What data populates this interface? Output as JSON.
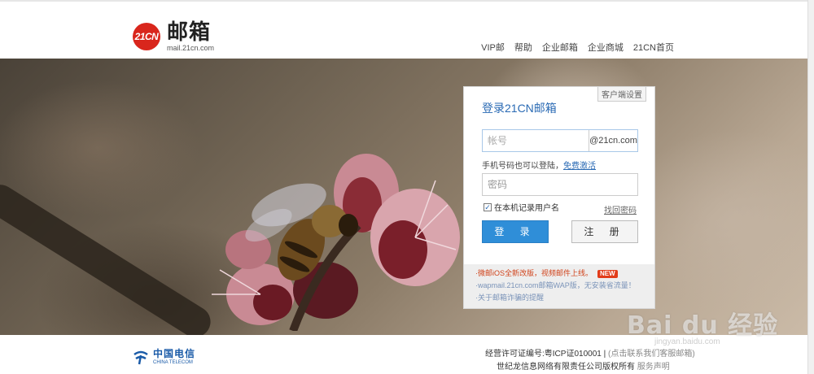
{
  "header": {
    "logo_badge": "21CN",
    "logo_title": "邮箱",
    "logo_sub": "mail.21cn.com",
    "nav": [
      "VIP邮",
      "帮助",
      "企业邮箱",
      "企业商城",
      "21CN首页"
    ]
  },
  "login": {
    "client_settings": "客户端设置",
    "title": "登录21CN邮箱",
    "username_placeholder": "帐号",
    "domain": "@21cn.com",
    "hint_text": "手机号码也可以登陆，",
    "hint_link": "免费激活",
    "password_placeholder": "密码",
    "remember_label": "在本机记录用户名",
    "remember_checked": true,
    "forgot_link": "找回密码",
    "login_button": "登 录",
    "register_button": "注 册"
  },
  "news": [
    {
      "text": "·微邮iOS全新改版，视频邮件上线。",
      "badge": "NEW"
    },
    {
      "text": "·wapmail.21cn.com邮箱WAP版，无安装省流量！"
    },
    {
      "text": "·关于邮箱诈骗的提醒"
    }
  ],
  "footer": {
    "telecom_cn": "中国电信",
    "telecom_en": "CHINA TELECOM",
    "license": "经营许可证编号:粤ICP证010001 |",
    "license_soft": "(点击联系我们客服邮箱)",
    "copyright": "世纪龙信息网络有限责任公司版权所有",
    "service_link": "服务声明"
  },
  "watermark": {
    "text": "Bai du 经验",
    "url": "jingyan.baidu.com"
  },
  "colors": {
    "brand_red": "#d9261c",
    "link_blue": "#2a6ab4",
    "login_button": "#2f8ed8"
  }
}
